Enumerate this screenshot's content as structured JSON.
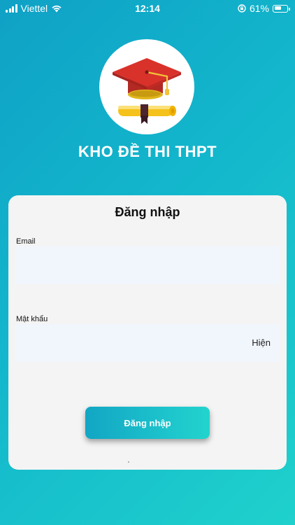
{
  "status_bar": {
    "carrier": "Viettel",
    "time": "12:14",
    "battery_percent_label": "61%",
    "battery_level": 0.61,
    "icons": [
      "signal-icon",
      "wifi-icon",
      "rotation-lock-icon",
      "battery-icon"
    ]
  },
  "app": {
    "title": "KHO ĐỀ THI THPT",
    "logo_icon": "graduation-cap-diploma-icon"
  },
  "login": {
    "heading": "Đăng nhập",
    "email": {
      "label": "Email",
      "value": "",
      "placeholder": ""
    },
    "password": {
      "label": "Mật khẩu",
      "value": "",
      "placeholder": "",
      "toggle_label": "Hiện"
    },
    "submit_label": "Đăng nhập"
  },
  "colors": {
    "background_start": "#0fa1c6",
    "background_end": "#1fd1cc",
    "card": "#f4f4f4",
    "field": "#f1f6fd",
    "button_start": "#12a6c4",
    "button_end": "#22d4cd",
    "cap_red": "#d9322b",
    "diploma_gold": "#f5c21b"
  }
}
